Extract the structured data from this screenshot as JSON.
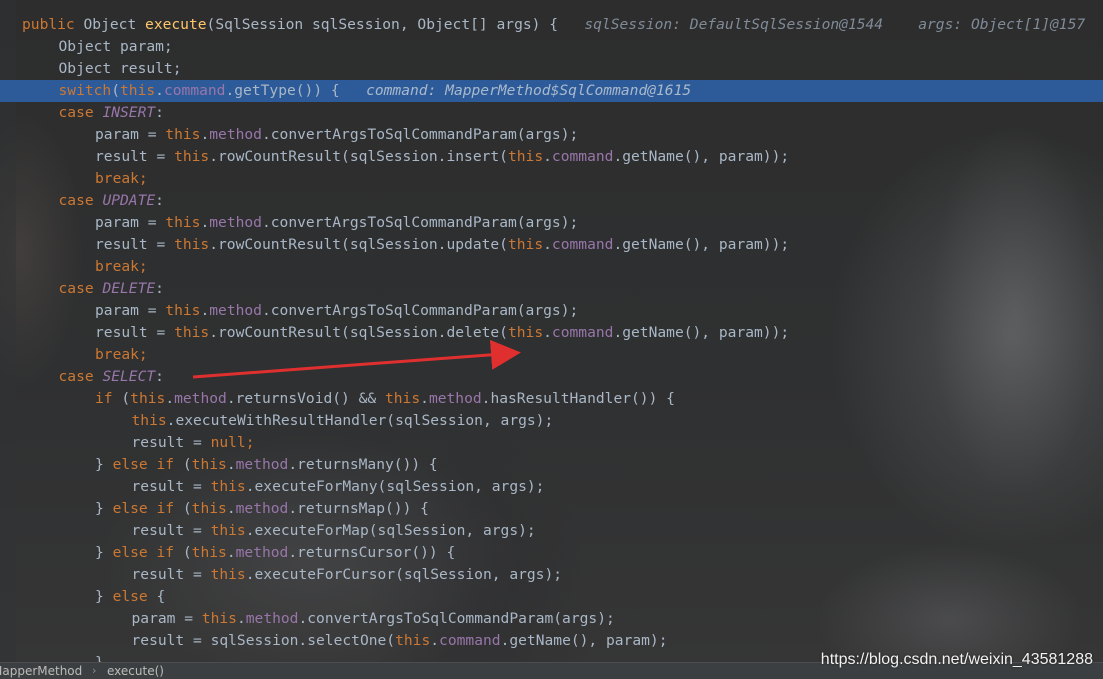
{
  "code_lines": [
    {
      "exec": false,
      "indent": 0,
      "tokens": [
        [
          "kw",
          "public "
        ],
        [
          "plain",
          "Object "
        ],
        [
          "fn",
          "execute"
        ],
        [
          "plain",
          "(SqlSession sqlSession, Object[] args) {"
        ],
        [
          "hint",
          "   sqlSession: DefaultSqlSession@1544    args: Object[1]@157"
        ]
      ]
    },
    {
      "exec": false,
      "indent": 1,
      "tokens": [
        [
          "plain",
          "Object param;"
        ]
      ]
    },
    {
      "exec": false,
      "indent": 1,
      "tokens": [
        [
          "plain",
          "Object result;"
        ]
      ]
    },
    {
      "exec": true,
      "indent": 1,
      "tokens": [
        [
          "kw",
          "switch"
        ],
        [
          "plain",
          "("
        ],
        [
          "kw",
          "this"
        ],
        [
          "plain",
          "."
        ],
        [
          "field",
          "command"
        ],
        [
          "plain",
          ".getType()) {"
        ],
        [
          "hint",
          "   command: MapperMethod$SqlCommand@1615"
        ]
      ]
    },
    {
      "exec": false,
      "indent": 1,
      "tokens": [
        [
          "kw",
          "case "
        ],
        [
          "enum",
          "INSERT"
        ],
        [
          "plain",
          ":"
        ]
      ]
    },
    {
      "exec": false,
      "indent": 2,
      "tokens": [
        [
          "plain",
          "param = "
        ],
        [
          "kw",
          "this"
        ],
        [
          "plain",
          "."
        ],
        [
          "field",
          "method"
        ],
        [
          "plain",
          ".convertArgsToSqlCommandParam(args);"
        ]
      ]
    },
    {
      "exec": false,
      "indent": 2,
      "tokens": [
        [
          "plain",
          "result = "
        ],
        [
          "kw",
          "this"
        ],
        [
          "plain",
          ".rowCountResult(sqlSession.insert("
        ],
        [
          "kw",
          "this"
        ],
        [
          "plain",
          "."
        ],
        [
          "field",
          "command"
        ],
        [
          "plain",
          ".getName(), param));"
        ]
      ]
    },
    {
      "exec": false,
      "indent": 2,
      "tokens": [
        [
          "kw",
          "break;"
        ]
      ]
    },
    {
      "exec": false,
      "indent": 1,
      "tokens": [
        [
          "kw",
          "case "
        ],
        [
          "enum",
          "UPDATE"
        ],
        [
          "plain",
          ":"
        ]
      ]
    },
    {
      "exec": false,
      "indent": 2,
      "tokens": [
        [
          "plain",
          "param = "
        ],
        [
          "kw",
          "this"
        ],
        [
          "plain",
          "."
        ],
        [
          "field",
          "method"
        ],
        [
          "plain",
          ".convertArgsToSqlCommandParam(args);"
        ]
      ]
    },
    {
      "exec": false,
      "indent": 2,
      "tokens": [
        [
          "plain",
          "result = "
        ],
        [
          "kw",
          "this"
        ],
        [
          "plain",
          ".rowCountResult(sqlSession.update("
        ],
        [
          "kw",
          "this"
        ],
        [
          "plain",
          "."
        ],
        [
          "field",
          "command"
        ],
        [
          "plain",
          ".getName(), param));"
        ]
      ]
    },
    {
      "exec": false,
      "indent": 2,
      "tokens": [
        [
          "kw",
          "break;"
        ]
      ]
    },
    {
      "exec": false,
      "indent": 1,
      "tokens": [
        [
          "kw",
          "case "
        ],
        [
          "enum",
          "DELETE"
        ],
        [
          "plain",
          ":"
        ]
      ]
    },
    {
      "exec": false,
      "indent": 2,
      "tokens": [
        [
          "plain",
          "param = "
        ],
        [
          "kw",
          "this"
        ],
        [
          "plain",
          "."
        ],
        [
          "field",
          "method"
        ],
        [
          "plain",
          ".convertArgsToSqlCommandParam(args);"
        ]
      ]
    },
    {
      "exec": false,
      "indent": 2,
      "tokens": [
        [
          "plain",
          "result = "
        ],
        [
          "kw",
          "this"
        ],
        [
          "plain",
          ".rowCountResult(sqlSession.delete("
        ],
        [
          "kw",
          "this"
        ],
        [
          "plain",
          "."
        ],
        [
          "field",
          "command"
        ],
        [
          "plain",
          ".getName(), param));"
        ]
      ]
    },
    {
      "exec": false,
      "indent": 2,
      "tokens": [
        [
          "kw",
          "break;"
        ]
      ]
    },
    {
      "exec": false,
      "indent": 1,
      "tokens": [
        [
          "kw",
          "case "
        ],
        [
          "enum",
          "SELECT"
        ],
        [
          "plain",
          ":"
        ]
      ]
    },
    {
      "exec": false,
      "indent": 2,
      "tokens": [
        [
          "kw",
          "if "
        ],
        [
          "plain",
          "("
        ],
        [
          "kw",
          "this"
        ],
        [
          "plain",
          "."
        ],
        [
          "field",
          "method"
        ],
        [
          "plain",
          ".returnsVoid() && "
        ],
        [
          "kw",
          "this"
        ],
        [
          "plain",
          "."
        ],
        [
          "field",
          "method"
        ],
        [
          "plain",
          ".hasResultHandler()) {"
        ]
      ]
    },
    {
      "exec": false,
      "indent": 3,
      "tokens": [
        [
          "kw",
          "this"
        ],
        [
          "plain",
          ".executeWithResultHandler(sqlSession, args);"
        ]
      ]
    },
    {
      "exec": false,
      "indent": 3,
      "tokens": [
        [
          "plain",
          "result = "
        ],
        [
          "kw",
          "null;"
        ]
      ]
    },
    {
      "exec": false,
      "indent": 2,
      "tokens": [
        [
          "plain",
          "} "
        ],
        [
          "kw",
          "else if "
        ],
        [
          "plain",
          "("
        ],
        [
          "kw",
          "this"
        ],
        [
          "plain",
          "."
        ],
        [
          "field",
          "method"
        ],
        [
          "plain",
          ".returnsMany()) {"
        ]
      ]
    },
    {
      "exec": false,
      "indent": 3,
      "tokens": [
        [
          "plain",
          "result = "
        ],
        [
          "kw",
          "this"
        ],
        [
          "plain",
          ".executeForMany(sqlSession, args);"
        ]
      ]
    },
    {
      "exec": false,
      "indent": 2,
      "tokens": [
        [
          "plain",
          "} "
        ],
        [
          "kw",
          "else if "
        ],
        [
          "plain",
          "("
        ],
        [
          "kw",
          "this"
        ],
        [
          "plain",
          "."
        ],
        [
          "field",
          "method"
        ],
        [
          "plain",
          ".returnsMap()) {"
        ]
      ]
    },
    {
      "exec": false,
      "indent": 3,
      "tokens": [
        [
          "plain",
          "result = "
        ],
        [
          "kw",
          "this"
        ],
        [
          "plain",
          ".executeForMap(sqlSession, args);"
        ]
      ]
    },
    {
      "exec": false,
      "indent": 2,
      "tokens": [
        [
          "plain",
          "} "
        ],
        [
          "kw",
          "else if "
        ],
        [
          "plain",
          "("
        ],
        [
          "kw",
          "this"
        ],
        [
          "plain",
          "."
        ],
        [
          "field",
          "method"
        ],
        [
          "plain",
          ".returnsCursor()) {"
        ]
      ]
    },
    {
      "exec": false,
      "indent": 3,
      "tokens": [
        [
          "plain",
          "result = "
        ],
        [
          "kw",
          "this"
        ],
        [
          "plain",
          ".executeForCursor(sqlSession, args);"
        ]
      ]
    },
    {
      "exec": false,
      "indent": 2,
      "tokens": [
        [
          "plain",
          "} "
        ],
        [
          "kw",
          "else "
        ],
        [
          "plain",
          "{"
        ]
      ]
    },
    {
      "exec": false,
      "indent": 3,
      "tokens": [
        [
          "plain",
          "param = "
        ],
        [
          "kw",
          "this"
        ],
        [
          "plain",
          "."
        ],
        [
          "field",
          "method"
        ],
        [
          "plain",
          ".convertArgsToSqlCommandParam(args);"
        ]
      ]
    },
    {
      "exec": false,
      "indent": 3,
      "tokens": [
        [
          "plain",
          "result = sqlSession.selectOne("
        ],
        [
          "kw",
          "this"
        ],
        [
          "plain",
          "."
        ],
        [
          "field",
          "command"
        ],
        [
          "plain",
          ".getName(), param);"
        ]
      ]
    },
    {
      "exec": false,
      "indent": 2,
      "tokens": [
        [
          "plain",
          "}"
        ]
      ]
    }
  ],
  "breadcrumb": {
    "class_name": "MapperMethod",
    "separator": "›",
    "method_name": "execute()"
  },
  "watermark": "https://blog.csdn.net/weixin_43581288",
  "colors": {
    "keyword": "#cc7832",
    "field": "#9876aa",
    "function": "#ffc66d",
    "plain": "#a9b7c6",
    "exec_highlight": "#2d5b99",
    "annotation_arrow": "#e02f2f"
  }
}
